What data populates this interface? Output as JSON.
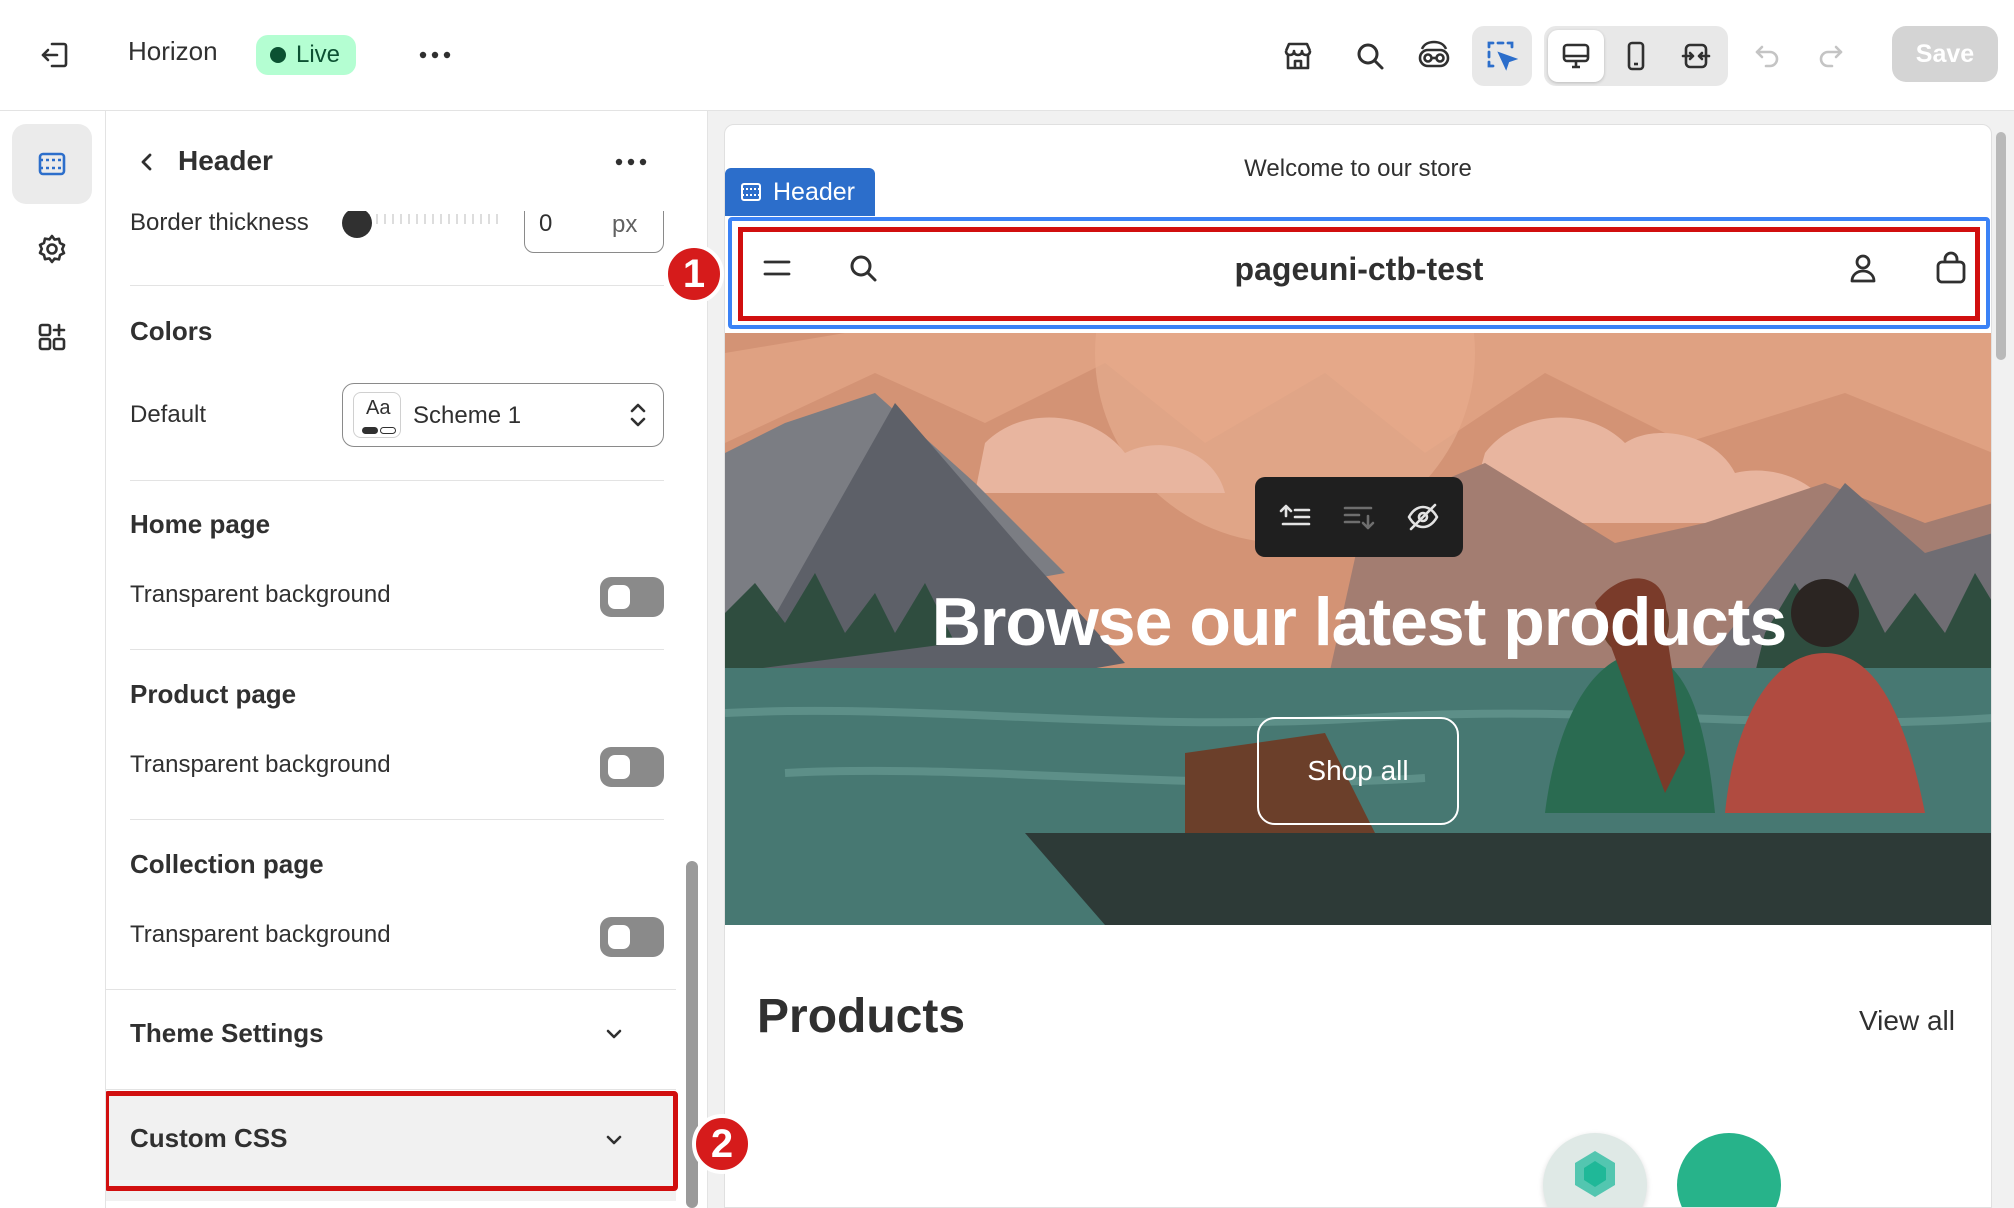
{
  "topbar": {
    "store_name": "Horizon",
    "status": "Live",
    "save_label": "Save",
    "icons": [
      "exit-icon",
      "more-icon",
      "storefront-icon",
      "search-icon",
      "preview-eye-icon",
      "inspector-icon",
      "desktop-icon",
      "mobile-icon",
      "fullwidth-icon",
      "undo-icon",
      "redo-icon"
    ]
  },
  "rail": {
    "items": [
      "sections-icon",
      "settings-gear-icon",
      "apps-icon"
    ]
  },
  "panel": {
    "title": "Header",
    "border_label": "Border thickness",
    "border_value": "0",
    "border_unit": "px",
    "colors_title": "Colors",
    "default_label": "Default",
    "scheme_swatch": "Aa",
    "scheme_value": "Scheme 1",
    "home_title": "Home page",
    "product_title": "Product page",
    "collection_title": "Collection page",
    "transparent_label": "Transparent background",
    "theme_settings": "Theme Settings",
    "custom_css": "Custom CSS"
  },
  "annotations": {
    "one": "1",
    "two": "2"
  },
  "preview": {
    "announcement": "Welcome to our store",
    "header_tag": "Header",
    "shop_name": "pageuni-ctb-test",
    "hero_title": "Browse our latest products",
    "hero_button": "Shop all",
    "products_title": "Products",
    "view_all": "View all"
  },
  "colors": {
    "accent": "#2c6ecb",
    "annotation": "#d10f0f",
    "live_bg": "#b4fed2"
  }
}
